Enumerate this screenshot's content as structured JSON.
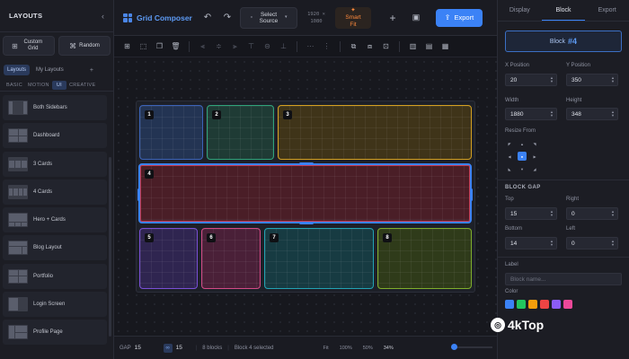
{
  "sidebar": {
    "title": "LAYOUTS",
    "collapse_icon": "chevron-left-icon",
    "buttons": [
      {
        "label": "Custom Grid",
        "icon": "grid-icon"
      },
      {
        "label": "Random",
        "icon": "shuffle-icon"
      }
    ],
    "tabs": [
      "Layouts",
      "My Layouts",
      "+"
    ],
    "categories": [
      "BASIC",
      "MOTION",
      "UI",
      "CREATIVE"
    ],
    "active_category": "UI",
    "items": [
      {
        "label": "Both Sidebars"
      },
      {
        "label": "Dashboard"
      },
      {
        "label": "3 Cards"
      },
      {
        "label": "4 Cards"
      },
      {
        "label": "Hero + Cards"
      },
      {
        "label": "Blog Layout"
      },
      {
        "label": "Portfolio"
      },
      {
        "label": "Login Screen"
      },
      {
        "label": "Profile Page"
      }
    ]
  },
  "header": {
    "app_name": "Grid Composer",
    "source_label": "Select Source",
    "dimensions": "1920 × 1080",
    "smart_fit": "Smart Fit",
    "export_label": "Export"
  },
  "canvas": {
    "blocks": [
      {
        "n": "1",
        "color": "#3b63b8",
        "fill": "#233453"
      },
      {
        "n": "2",
        "color": "#2fa37a",
        "fill": "#1f3b35"
      },
      {
        "n": "3",
        "color": "#d4a020",
        "fill": "#3f3419"
      },
      {
        "n": "4",
        "color": "#c83a4e",
        "fill": "#4a1e27",
        "selected": true
      },
      {
        "n": "5",
        "color": "#7a4fd6",
        "fill": "#2f2550"
      },
      {
        "n": "6",
        "color": "#d24a86",
        "fill": "#4a2038"
      },
      {
        "n": "7",
        "color": "#22a3b4",
        "fill": "#173b42"
      },
      {
        "n": "8",
        "color": "#7fae2c",
        "fill": "#2f3b1a"
      }
    ]
  },
  "status": {
    "gap_label": "GAP",
    "gap_x": "15",
    "gap_y": "15",
    "blocks_count": "8 blocks",
    "selection": "Block 4 selected",
    "zoom_options": [
      "Fit",
      "100%",
      "50%"
    ],
    "zoom_value": "34%",
    "zoom_level": 0
  },
  "panel": {
    "tabs": [
      "Display",
      "Block",
      "Export"
    ],
    "active_tab": "Block",
    "block_label": "Block",
    "block_id": "#4",
    "x_label": "X Position",
    "x_value": "20",
    "y_label": "Y Position",
    "y_value": "350",
    "w_label": "Width",
    "w_value": "1880",
    "h_label": "Height",
    "h_value": "348",
    "resize_label": "Resize From",
    "gap_title": "BLOCK GAP",
    "top_label": "Top",
    "top_value": "15",
    "right_label": "Right",
    "right_value": "0",
    "bottom_label": "Bottom",
    "bottom_value": "14",
    "left_label": "Left",
    "left_value": "0",
    "label_label": "Label",
    "label_placeholder": "Block name...",
    "color_label": "Color",
    "swatches": [
      "#3b82f6",
      "#22c55e",
      "#f59e0b",
      "#ef4444",
      "#8b5cf6",
      "#ec4899"
    ]
  },
  "watermark": "4kTop"
}
